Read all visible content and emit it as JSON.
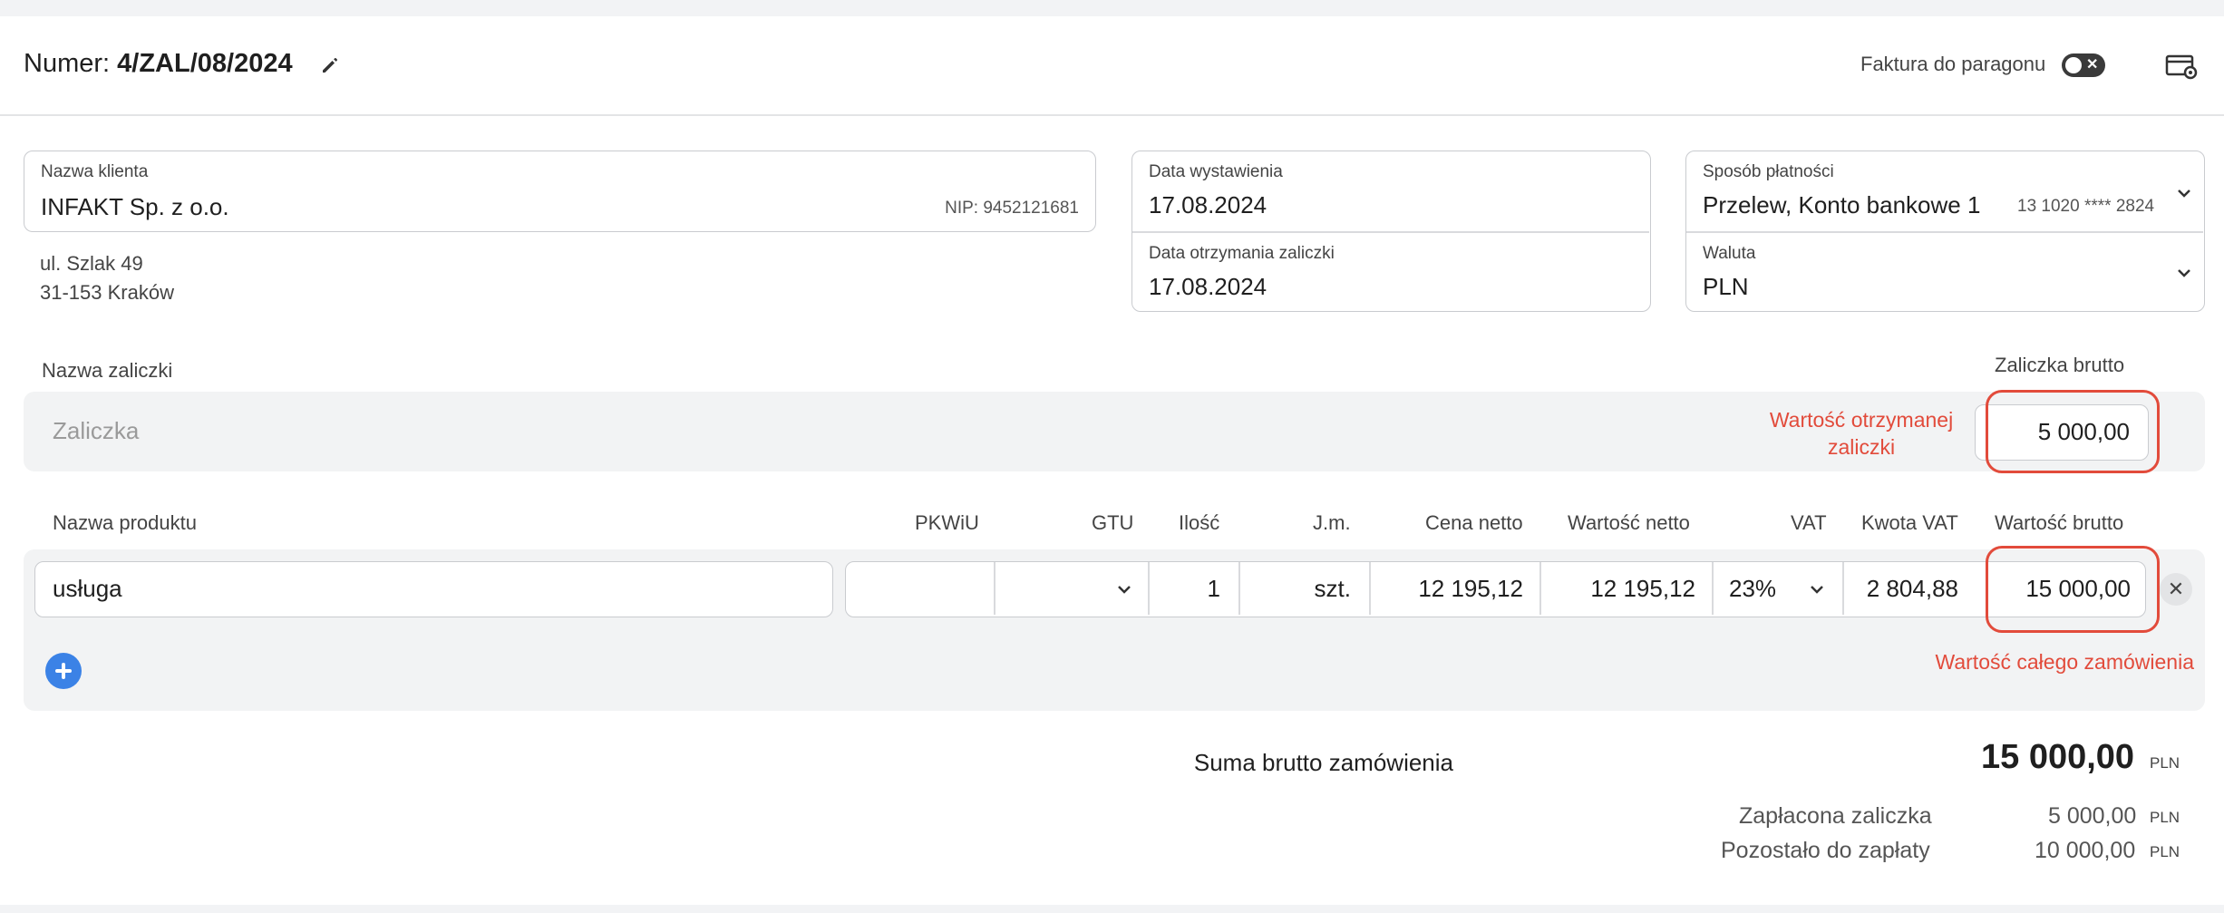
{
  "header": {
    "number_prefix": "Numer:",
    "number_value": "4/ZAL/08/2024",
    "toggle_label": "Faktura do paragonu",
    "toggle_on": false
  },
  "client": {
    "label": "Nazwa klienta",
    "name": "INFAKT Sp. z o.o.",
    "nip": "NIP: 9452121681",
    "address_line1": "ul. Szlak 49",
    "address_line2": "31-153 Kraków"
  },
  "dates": {
    "issue_label": "Data wystawienia",
    "issue_value": "17.08.2024",
    "received_label": "Data otrzymania zaliczki",
    "received_value": "17.08.2024"
  },
  "payment": {
    "method_label": "Sposób płatności",
    "method_value": "Przelew, Konto bankowe 1",
    "account": "13 1020 **** 2824",
    "currency_label": "Waluta",
    "currency_value": "PLN"
  },
  "advance": {
    "name_label": "Nazwa zaliczki",
    "name_placeholder": "Zaliczka",
    "gross_label": "Zaliczka brutto",
    "note": "Wartość otrzymanej zaliczki",
    "gross_value": "5 000,00"
  },
  "products": {
    "headers": {
      "name": "Nazwa produktu",
      "pkwiu": "PKWiU",
      "gtu": "GTU",
      "qty": "Ilość",
      "unit": "J.m.",
      "net_price": "Cena netto",
      "net_value": "Wartość netto",
      "vat": "VAT",
      "vat_amount": "Kwota VAT",
      "gross_value": "Wartość brutto"
    },
    "row": {
      "name": "usługa",
      "pkwiu": "",
      "gtu": "",
      "qty": "1",
      "unit": "szt.",
      "net_price": "12 195,12",
      "net_value": "12 195,12",
      "vat": "23%",
      "vat_amount": "2 804,88",
      "gross_value": "15 000,00"
    },
    "order_note": "Wartość całego zamówienia"
  },
  "summary": {
    "gross_total_label": "Suma brutto zamówienia",
    "gross_total_value": "15 000,00",
    "paid_label": "Zapłacona zaliczka",
    "paid_value": "5 000,00",
    "remaining_label": "Pozostało do zapłaty",
    "remaining_value": "10 000,00",
    "currency": "PLN"
  },
  "colors": {
    "accent": "#3b82e6",
    "highlight": "#e24b3b"
  },
  "icons": {
    "edit": "pencil-icon",
    "settings": "settings-icon",
    "add": "plus-icon",
    "remove": "close-icon"
  }
}
